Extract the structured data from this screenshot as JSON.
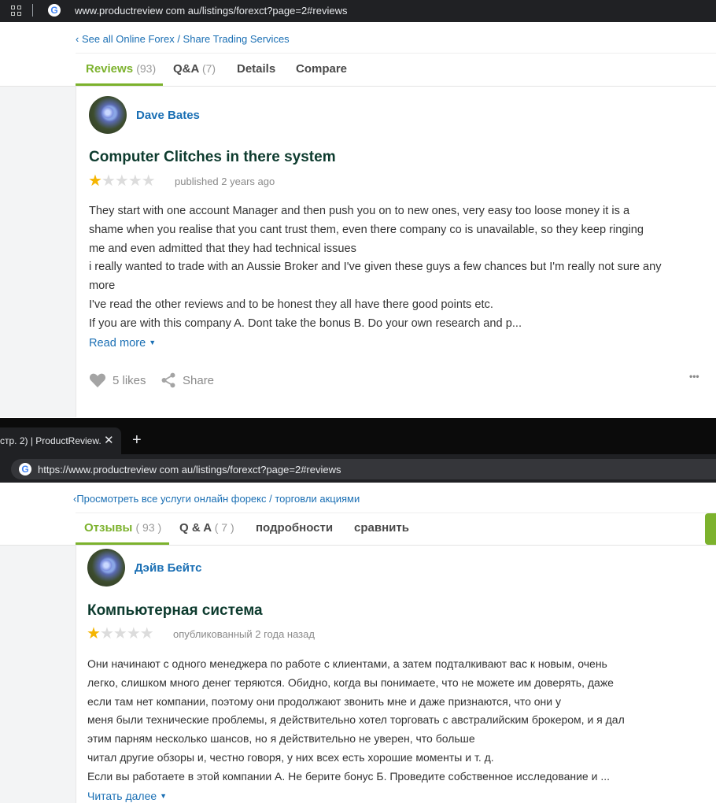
{
  "browser_top": {
    "url": "www.productreview com au/listings/forexct?page=2#reviews"
  },
  "section_en": {
    "back_link": "‹ See all Online Forex / Share Trading Services",
    "tabs": [
      {
        "label": "Reviews",
        "count": "(93)"
      },
      {
        "label": "Q&A",
        "count": "(7)"
      },
      {
        "label": "Details",
        "count": ""
      },
      {
        "label": "Compare",
        "count": ""
      }
    ],
    "review": {
      "author": "Dave Bates",
      "title": "Computer Clitches in there system",
      "rating": 1,
      "rating_max": 5,
      "published": "published 2 years ago",
      "body_lines": [
        "They start with one account Manager and then push you on to new ones, very easy too loose money it is a",
        "shame when you realise that you cant trust them, even there company co is unavailable, so they keep ringing",
        "me and even admitted that they had technical issues",
        "i really wanted to trade with an Aussie Broker and I've given these guys a few chances but I'm really not sure any",
        "more",
        "I've read the other reviews and to be honest they all have there good points etc.",
        "If you are with this company A. Dont take the bonus B. Do your own research and p..."
      ],
      "read_more": "Read more",
      "likes": "5 likes",
      "share": "Share",
      "more": "•••"
    }
  },
  "browser_bottom": {
    "tab_title": "стр. 2) | ProductReview.",
    "tab_close": "✕",
    "new_tab": "+",
    "url": "https://www.productreview com au/listings/forexct?page=2#reviews"
  },
  "section_ru": {
    "back_link": "‹Просмотреть все услуги онлайн форекс / торговли акциями",
    "tabs": [
      {
        "label": "Отзывы",
        "count": "( 93 )"
      },
      {
        "label": "Q & A",
        "count": "( 7 )"
      },
      {
        "label": "подробности",
        "count": ""
      },
      {
        "label": "сравнить",
        "count": ""
      }
    ],
    "review": {
      "author": "Дэйв Бейтс",
      "title": "Компьютерная система",
      "rating": 1,
      "rating_max": 5,
      "published": "опубликованный 2 года назад",
      "body_lines": [
        "Они начинают с одного менеджера по работе с клиентами, а затем подталкивают вас к новым, очень",
        "легко, слишком много денег теряются. Обидно, когда вы понимаете, что не можете им доверять, даже",
        "если там нет компании, поэтому они продолжают звонить мне и даже признаются, что они у",
        "меня были технические проблемы, я действительно хотел торговать с австралийским брокером, и я дал",
        "этим парням несколько шансов, но я действительно не уверен, что больше",
        "читал другие обзоры и, честно говоря, у них всех есть хорошие моменты и т. д.",
        "Если вы работаете в этой компании А. Не берите бонус Б. Проведите собственное исследование и ..."
      ],
      "read_more": "Читать далее"
    }
  },
  "colors": {
    "accent_green": "#7cb22d",
    "link_blue": "#1a6fb4",
    "title_dark_green": "#0d3b2e",
    "star_gold": "#f5b501",
    "chrome_dark": "#202124"
  },
  "icons": [
    "apps-grid-icon",
    "google-g-icon",
    "heart-icon",
    "share-icon",
    "more-dots-icon",
    "close-icon",
    "plus-icon",
    "caret-down-icon"
  ]
}
